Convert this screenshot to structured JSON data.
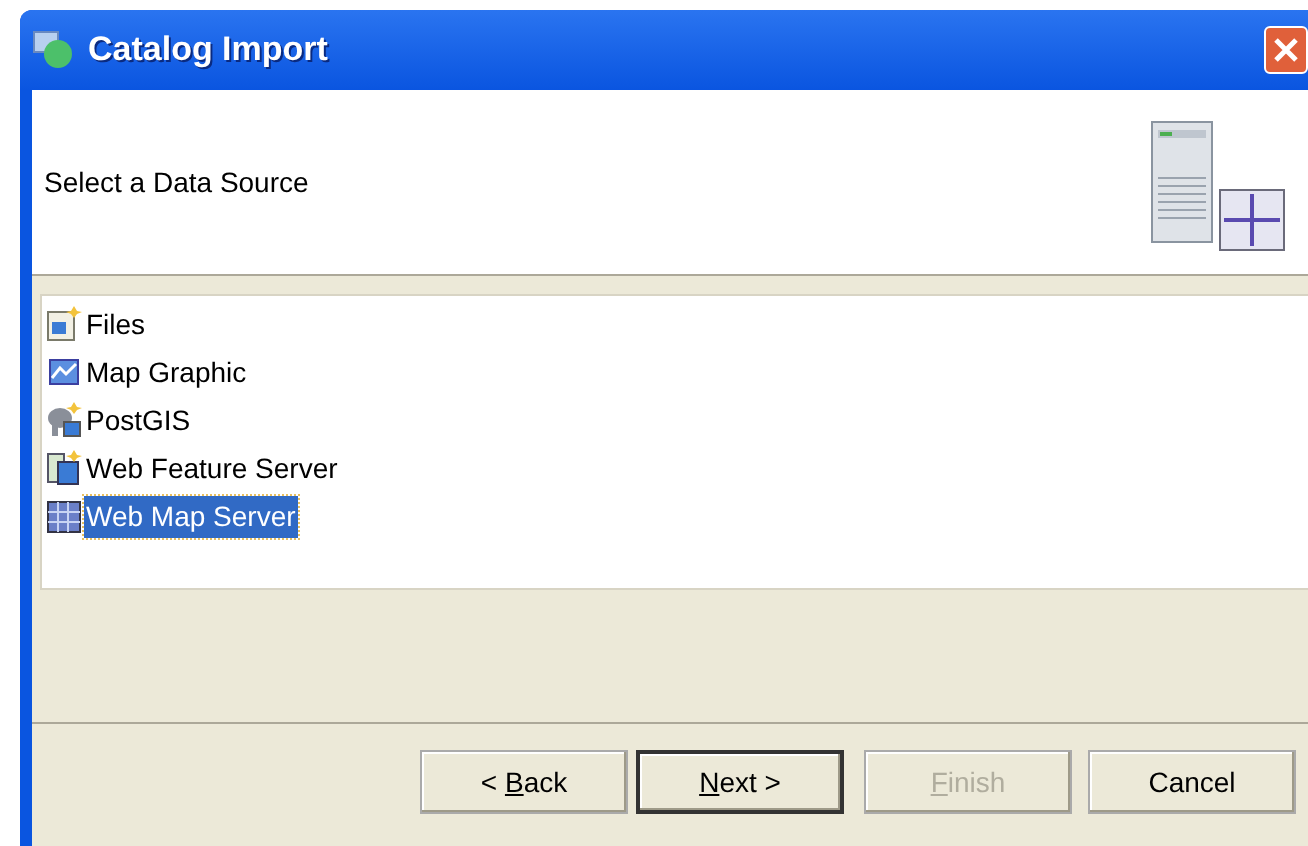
{
  "window": {
    "title": "Catalog Import"
  },
  "header": {
    "text": "Select a Data Source"
  },
  "sources": [
    {
      "label": "Files",
      "kind": "files",
      "selected": false
    },
    {
      "label": "Map Graphic",
      "kind": "graphic",
      "selected": false
    },
    {
      "label": "PostGIS",
      "kind": "postgis",
      "selected": false
    },
    {
      "label": "Web Feature Server",
      "kind": "wfs",
      "selected": false
    },
    {
      "label": "Web Map Server",
      "kind": "wms",
      "selected": true
    }
  ],
  "buttons": [
    {
      "before": "< ",
      "key": "B",
      "after": "ack",
      "disabled": false,
      "default": false
    },
    {
      "key": "N",
      "after": "ext >",
      "disabled": false,
      "default": true
    },
    {
      "key": "F",
      "after": "inish",
      "disabled": true,
      "default": false
    },
    {
      "before": "Cancel",
      "disabled": false,
      "default": false
    }
  ]
}
